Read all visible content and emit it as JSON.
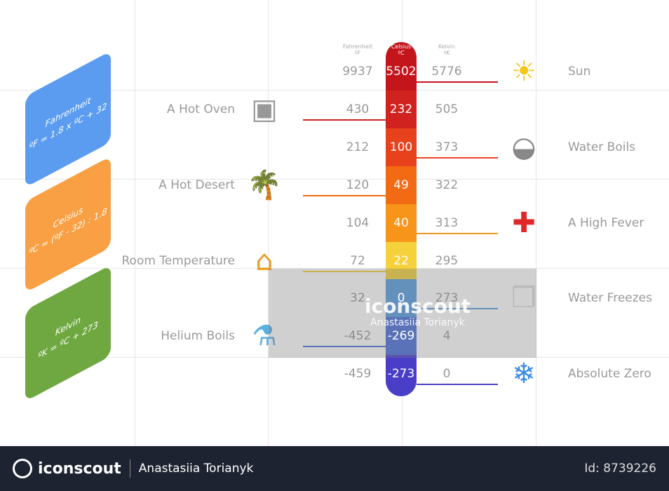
{
  "cards": [
    {
      "title": "Fahrenheit",
      "formula": "ºF = 1.8 x ºC + 32",
      "color": "#5b9cf0"
    },
    {
      "title": "Celsius",
      "formula": "ºC = (ºF - 32) : 1.8",
      "color": "#f8a043"
    },
    {
      "title": "Kelvin",
      "formula": "ºK = ºC + 273",
      "color": "#6fa840"
    }
  ],
  "headers": {
    "fahrenheit": "Fahrenheit",
    "fahrenheit_unit": "ºF",
    "celsius": "Celsius",
    "celsius_unit": "ºC",
    "kelvin": "Kelvin",
    "kelvin_unit": "ºK"
  },
  "rows": [
    {
      "f": "9937",
      "c": "5502",
      "k": "5776",
      "label": "Sun",
      "side": "right",
      "color": "#c4141c",
      "icon": "sun-icon"
    },
    {
      "f": "430",
      "c": "232",
      "k": "505",
      "label": "A Hot Oven",
      "side": "left",
      "color": "#d0221e",
      "icon": "oven-icon"
    },
    {
      "f": "212",
      "c": "100",
      "k": "373",
      "label": "Water Boils",
      "side": "right",
      "color": "#e8421c",
      "icon": "pot-icon"
    },
    {
      "f": "120",
      "c": "49",
      "k": "322",
      "label": "A Hot Desert",
      "side": "left",
      "color": "#f26a14",
      "icon": "palm-tree-icon"
    },
    {
      "f": "104",
      "c": "40",
      "k": "313",
      "label": "A High Fever",
      "side": "right",
      "color": "#f7941a",
      "icon": "first-aid-kit-icon"
    },
    {
      "f": "72",
      "c": "22",
      "k": "295",
      "label": "Room Temperature",
      "side": "left",
      "color": "#f5d23c",
      "icon": "house-icon"
    },
    {
      "f": "32",
      "c": "0",
      "k": "273",
      "label": "Water Freezes",
      "side": "right",
      "color": "#5a9de0",
      "icon": "ice-cubes-icon"
    },
    {
      "f": "-452",
      "c": "-269",
      "k": "4",
      "label": "Helium Boils",
      "side": "left",
      "color": "#4a70da",
      "icon": "flask-icon"
    },
    {
      "f": "-459",
      "c": "-273",
      "k": "0",
      "label": "Absolute Zero",
      "side": "right",
      "color": "#4a3ec8",
      "icon": "snowflake-icon"
    }
  ],
  "watermark": {
    "brand": "iconscout",
    "author": "Anastasiia Torianyk"
  },
  "footer": {
    "brand": "iconscout",
    "author": "Anastasiia Torianyk",
    "id": "Id: 8739226"
  }
}
